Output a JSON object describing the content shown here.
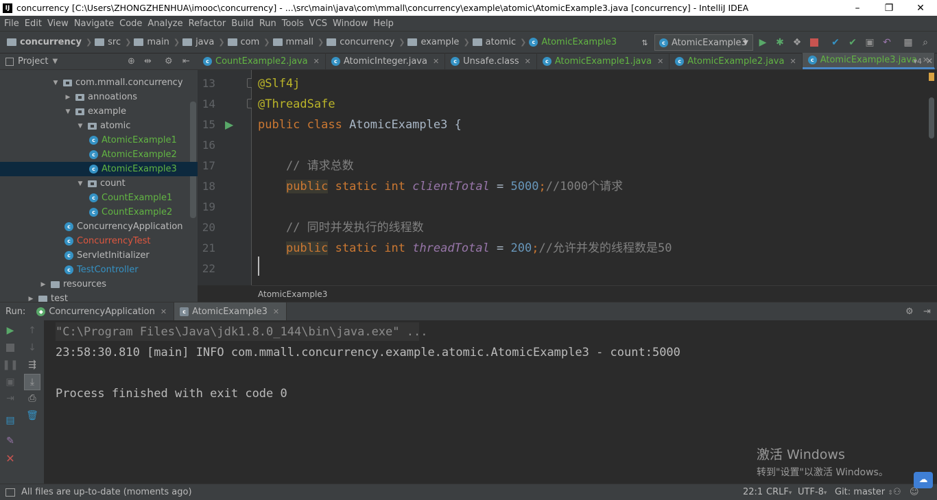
{
  "window": {
    "title": "concurrency [C:\\Users\\ZHONGZHENHUA\\imooc\\concurrency] - ...\\src\\main\\java\\com\\mmall\\concurrency\\example\\atomic\\AtomicExample3.java [concurrency] - IntelliJ IDEA",
    "app_icon": "IJ",
    "minimize": "–",
    "maximize": "❐",
    "close": "✕"
  },
  "menu": [
    "File",
    "Edit",
    "View",
    "Navigate",
    "Code",
    "Analyze",
    "Refactor",
    "Build",
    "Run",
    "Tools",
    "VCS",
    "Window",
    "Help"
  ],
  "breadcrumb": [
    "concurrency",
    "src",
    "main",
    "java",
    "com",
    "mmall",
    "concurrency",
    "example",
    "atomic",
    "AtomicExample3"
  ],
  "run_config": {
    "label": "AtomicExample3"
  },
  "project_panel": {
    "title": "Project"
  },
  "tree": [
    {
      "label": "com.mmall.concurrency",
      "indent": 76,
      "arrow": "▼",
      "kind": "pkg",
      "color": "#bbbbbb"
    },
    {
      "label": "annoations",
      "indent": 94,
      "arrow": "▶",
      "kind": "pkg",
      "color": "#bbbbbb"
    },
    {
      "label": "example",
      "indent": 94,
      "arrow": "▼",
      "kind": "pkg",
      "color": "#bbbbbb"
    },
    {
      "label": "atomic",
      "indent": 112,
      "arrow": "▼",
      "kind": "pkg",
      "color": "#bbbbbb"
    },
    {
      "label": "AtomicExample1",
      "indent": 130,
      "arrow": "",
      "kind": "class",
      "color": "#62b543"
    },
    {
      "label": "AtomicExample2",
      "indent": 130,
      "arrow": "",
      "kind": "class",
      "color": "#62b543"
    },
    {
      "label": "AtomicExample3",
      "indent": 130,
      "arrow": "",
      "kind": "class",
      "color": "#62b543",
      "selected": true
    },
    {
      "label": "count",
      "indent": 112,
      "arrow": "▼",
      "kind": "pkg",
      "color": "#bbbbbb"
    },
    {
      "label": "CountExample1",
      "indent": 130,
      "arrow": "",
      "kind": "class",
      "color": "#62b543"
    },
    {
      "label": "CountExample2",
      "indent": 130,
      "arrow": "",
      "kind": "class",
      "color": "#62b543"
    },
    {
      "label": "ConcurrencyApplication",
      "indent": 94,
      "arrow": "",
      "kind": "class",
      "color": "#bbbbbb"
    },
    {
      "label": "ConcurrencyTest",
      "indent": 94,
      "arrow": "",
      "kind": "class",
      "color": "#e0573f"
    },
    {
      "label": "ServletInitializer",
      "indent": 94,
      "arrow": "",
      "kind": "class",
      "color": "#bbbbbb"
    },
    {
      "label": "TestController",
      "indent": 94,
      "arrow": "",
      "kind": "class",
      "color": "#3592c4"
    },
    {
      "label": "resources",
      "indent": 58,
      "arrow": "▶",
      "kind": "folder",
      "color": "#bbbbbb"
    },
    {
      "label": "test",
      "indent": 40,
      "arrow": "▶",
      "kind": "folder",
      "color": "#bbbbbb"
    }
  ],
  "editor_tabs": [
    {
      "label": "CountExample2.java",
      "color": "#62b543",
      "active": false
    },
    {
      "label": "AtomicInteger.java",
      "color": "#bbbbbb",
      "active": false
    },
    {
      "label": "Unsafe.class",
      "color": "#bbbbbb",
      "active": false
    },
    {
      "label": "AtomicExample1.java",
      "color": "#62b543",
      "active": false
    },
    {
      "label": "AtomicExample2.java",
      "color": "#62b543",
      "active": false
    },
    {
      "label": "AtomicExample3.java",
      "color": "#62b543",
      "active": true
    }
  ],
  "code_lines": [
    {
      "n": "13",
      "parts": [
        [
          "ann",
          "@Slf4j"
        ]
      ]
    },
    {
      "n": "14",
      "parts": [
        [
          "ann",
          "@ThreadSafe"
        ]
      ]
    },
    {
      "n": "15",
      "parts": [
        [
          "kw",
          "public class "
        ],
        [
          "txt",
          "AtomicExample3 {"
        ]
      ]
    },
    {
      "n": "16",
      "parts": []
    },
    {
      "n": "17",
      "parts": [
        [
          "txt",
          "    "
        ],
        [
          "cmt",
          "// 请求总数"
        ]
      ]
    },
    {
      "n": "18",
      "parts": [
        [
          "txt",
          "    "
        ],
        [
          "kwh",
          "public"
        ],
        [
          "kw",
          " static int "
        ],
        [
          "fld",
          "clientTotal"
        ],
        [
          "txt",
          " = "
        ],
        [
          "num",
          "5000"
        ],
        [
          "kw",
          ";"
        ],
        [
          "cmt",
          "//1000个请求"
        ]
      ]
    },
    {
      "n": "19",
      "parts": []
    },
    {
      "n": "20",
      "parts": [
        [
          "txt",
          "    "
        ],
        [
          "cmt",
          "// 同时并发执行的线程数"
        ]
      ]
    },
    {
      "n": "21",
      "parts": [
        [
          "txt",
          "    "
        ],
        [
          "kwh",
          "public"
        ],
        [
          "kw",
          " static int "
        ],
        [
          "fld",
          "threadTotal"
        ],
        [
          "txt",
          " = "
        ],
        [
          "num",
          "200"
        ],
        [
          "kw",
          ";"
        ],
        [
          "cmt",
          "//允许并发的线程数是50"
        ]
      ]
    },
    {
      "n": "22",
      "parts": []
    }
  ],
  "editor_breadcrumb": "AtomicExample3",
  "run_panel": {
    "label": "Run:",
    "tabs": [
      "ConcurrencyApplication",
      "AtomicExample3"
    ]
  },
  "console_lines": [
    "\"C:\\Program Files\\Java\\jdk1.8.0_144\\bin\\java.exe\" ...",
    "23:58:30.810 [main] INFO com.mmall.concurrency.example.atomic.AtomicExample3 - count:5000",
    "",
    "Process finished with exit code 0"
  ],
  "status": {
    "message": "All files are up-to-date (moments ago)",
    "position": "22:1",
    "line_sep": "CRLF",
    "encoding": "UTF-8",
    "vcs": "Git: master"
  },
  "watermark": {
    "line1": "激活 Windows",
    "line2": "转到\"设置\"以激活 Windows。"
  }
}
